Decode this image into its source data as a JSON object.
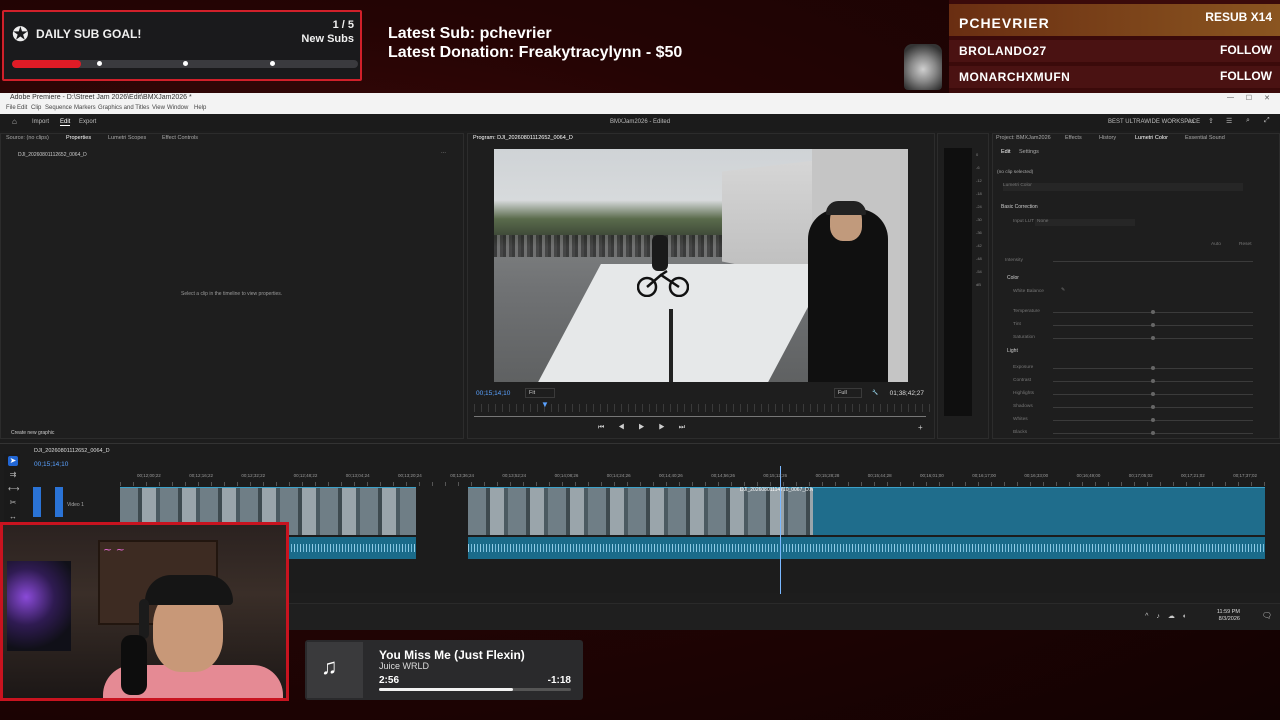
{
  "overlay": {
    "goal": {
      "title": "DAILY SUB GOAL!",
      "count": "1 / 5",
      "label": "New Subs",
      "progress": 0.2,
      "accent": "#e01b26"
    },
    "latest_sub": "Latest Sub: pchevrier",
    "latest_donation": "Latest Donation: Freakytracylynn  - $50",
    "featured": [
      {
        "name": "PCHEVRIER",
        "action": "RESUB X14"
      },
      {
        "name": "BROLANDO27",
        "action": "FOLLOW"
      },
      {
        "name": "MONARCHXMUFN",
        "action": "FOLLOW"
      }
    ]
  },
  "premiere": {
    "window_title": "Adobe Premiere - D:\\Street Jam 2026\\Edit\\BMXJam2026 *",
    "menu": [
      "File",
      "Edit",
      "Clip",
      "Sequence",
      "Markers",
      "Graphics and Titles",
      "View",
      "Window",
      "Help"
    ],
    "modes": [
      "Import",
      "Edit",
      "Export"
    ],
    "active_mode": "Edit",
    "project_title": "BMXJam2026 - Edited",
    "workspace": "BEST ULTRAWIDE WORKSPACE",
    "left_panel": {
      "tabs": [
        "Source: (no clips)",
        "Properties",
        "Lumetri Scopes",
        "Effect Controls"
      ],
      "clip_name": "DJI_20260801112652_0064_D",
      "empty_msg": "Select a clip in the timeline to view properties.",
      "footer": "Create new graphic"
    },
    "program": {
      "title": "Program: DJI_20260801112652_0064_D",
      "timecode": "00;15;14;10",
      "fit": "Fit",
      "quality": "Full",
      "duration": "01;38;42;27",
      "controls": "⏮ ◀ ▶ ▶ ⏭"
    },
    "meter_scale": [
      "0",
      "-6",
      "-12",
      "-18",
      "-24",
      "-30",
      "-36",
      "-42",
      "-48",
      "-54",
      "dB"
    ],
    "lumetri": {
      "tabs": [
        "Project: BMXJam2026",
        "Effects",
        "History",
        "Lumetri Color",
        "Essential Sound"
      ],
      "subtabs": [
        "Edit",
        "Settings"
      ],
      "no_clip": "(no clip selected)",
      "preset": "Lumetri Color",
      "basic": "Basic Correction",
      "input_lut": "Input LUT",
      "lut_value": "None",
      "auto": "Auto",
      "reset": "Reset",
      "intensity": "Intensity",
      "color": "Color",
      "white_balance": "White Balance",
      "color_rows": [
        "Temperature",
        "Tint",
        "Saturation"
      ],
      "light": "Light",
      "light_rows": [
        "Exposure",
        "Contrast",
        "Highlights",
        "Shadows",
        "Whites",
        "Blacks"
      ]
    },
    "timeline": {
      "sequence": "DJI_20260801112652_0064_D",
      "timecode": "00;15;14;10",
      "ticks": [
        "00;12;00;22",
        "00;12;16;22",
        "00;12;32;22",
        "00;12;48;22",
        "00;13;04;24",
        "00;13;20;24",
        "00;13;36;24",
        "00;13;52;24",
        "00;14;08;26",
        "00;14;24;26",
        "00;14;40;26",
        "00;14;56;26",
        "00;15;12;26",
        "00;15;28;28",
        "00;15;44;28",
        "00;16;01;00",
        "00;16;17;00",
        "00;16;33;00",
        "00;16;49;00",
        "00;17;05;02",
        "00;17;21;02",
        "00;17;37;02"
      ],
      "video_track": "Video 1",
      "clip_label": "DJI_20260801114710_0067_D.MP4 [V]"
    },
    "clock": {
      "time": "11:59 PM",
      "date": "8/3/2026"
    }
  },
  "now_playing": {
    "song": "You Miss Me (Just Flexin)",
    "artist": "Juice WRLD",
    "elapsed": "2:56",
    "remaining": "-1:18",
    "progress": 0.7
  }
}
